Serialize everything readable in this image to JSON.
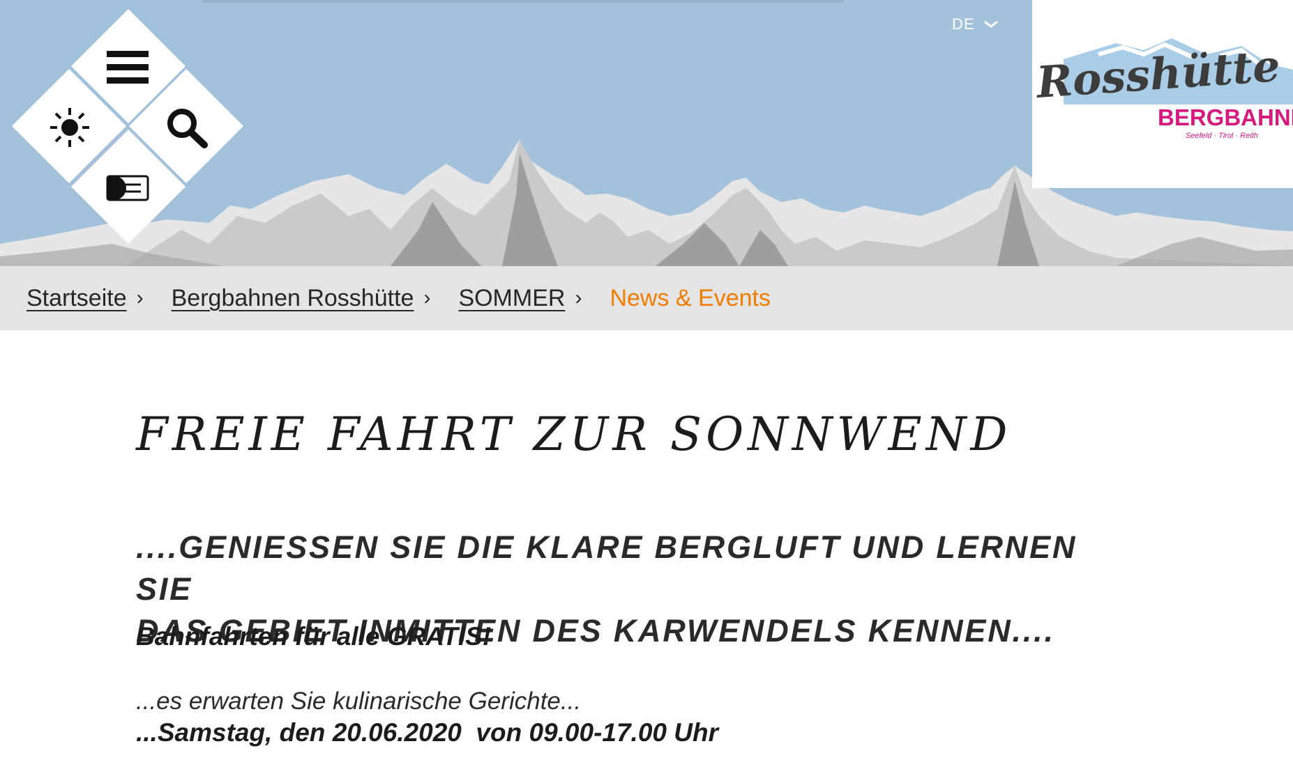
{
  "header": {
    "language": "DE",
    "menu_icons": [
      "menu-icon",
      "weather-sun-icon",
      "search-icon",
      "ticket-card-icon"
    ]
  },
  "logo": {
    "name": "Rosshütte",
    "sub": "BERGBAHNEN",
    "places": "Seefeld · Tirol · Reith",
    "brand_pink": "#d6197d",
    "brand_dark": "#3c3c3c",
    "sky_blue": "#a9cde6"
  },
  "breadcrumb": {
    "items": [
      "Startseite",
      "Bergbahnen Rosshütte",
      "SOMMER"
    ],
    "current": "News & Events",
    "separator": "›",
    "accent": "#ef7d00"
  },
  "article": {
    "title": "FREIE FAHRT ZUR SONNWEND",
    "subtitle_line1": "....GENIESSEN SIE DIE KLARE BERGLUFT UND LERNEN SIE",
    "subtitle_line2": "DAS GEBIET INMITTEN DES KARWENDELS KENNEN....",
    "bold_line": "Bahnfahrten für alle GRATIS!",
    "culinary_line": "...es erwarten Sie kulinarische Gerichte...",
    "date_line": "...Samstag, den 20.06.2020  von 09.00-17.00 Uhr"
  }
}
